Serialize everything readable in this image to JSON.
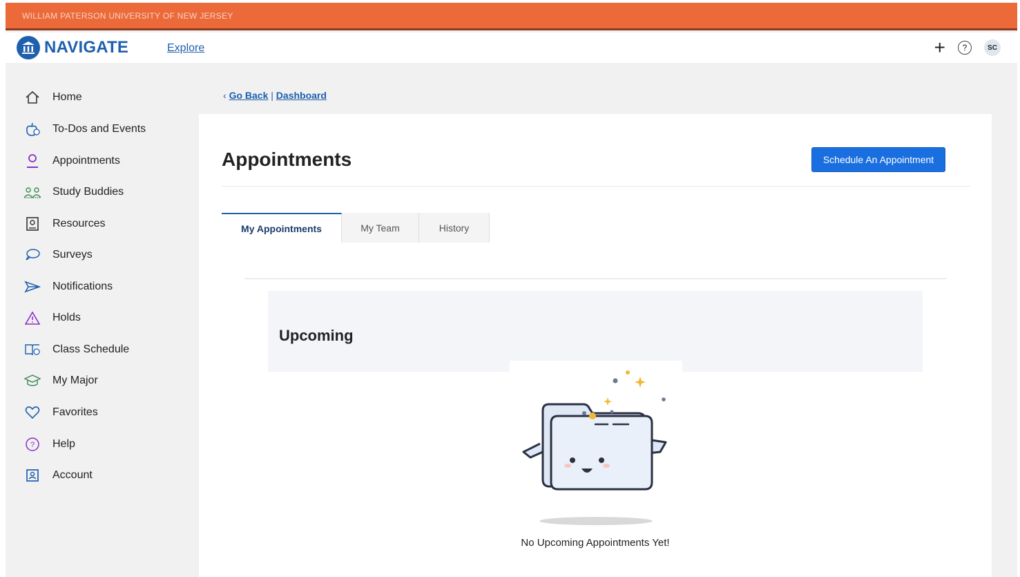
{
  "header": {
    "university": "WILLIAM PATERSON UNIVERSITY OF NEW JERSEY",
    "app_name": "NAVIGATE",
    "explore_label": "Explore",
    "add_icon": "plus-icon",
    "help_icon": "question-circle-icon",
    "user_initials": "SC"
  },
  "sidebar": {
    "items": [
      {
        "label": "Home",
        "icon": "home-icon"
      },
      {
        "label": "To-Dos and Events",
        "icon": "todo-icon"
      },
      {
        "label": "Appointments",
        "icon": "person-icon"
      },
      {
        "label": "Study Buddies",
        "icon": "group-icon"
      },
      {
        "label": "Resources",
        "icon": "resources-icon"
      },
      {
        "label": "Surveys",
        "icon": "chat-bubble-icon"
      },
      {
        "label": "Notifications",
        "icon": "send-icon"
      },
      {
        "label": "Holds",
        "icon": "warning-icon"
      },
      {
        "label": "Class Schedule",
        "icon": "book-icon"
      },
      {
        "label": "My Major",
        "icon": "graduation-cap-icon"
      },
      {
        "label": "Favorites",
        "icon": "heart-icon"
      },
      {
        "label": "Help",
        "icon": "question-circle-icon"
      },
      {
        "label": "Account",
        "icon": "account-icon"
      }
    ]
  },
  "breadcrumb": {
    "back_label": "Go Back",
    "separator": "|",
    "current_label": "Dashboard"
  },
  "main": {
    "title": "Appointments",
    "schedule_button": "Schedule An Appointment",
    "tabs": [
      {
        "label": "My Appointments",
        "active": true
      },
      {
        "label": "My Team",
        "active": false
      },
      {
        "label": "History",
        "active": false
      }
    ],
    "section_title": "Upcoming",
    "empty_message": "No Upcoming Appointments Yet!"
  },
  "colors": {
    "topbar": "#ec6a3a",
    "brand_blue": "#1e5fae",
    "button_blue": "#1a6fe0",
    "sidebar_icon_purple": "#8a2fc4",
    "sidebar_icon_blue": "#1e5fae",
    "sidebar_icon_green": "#3f8c5a"
  }
}
